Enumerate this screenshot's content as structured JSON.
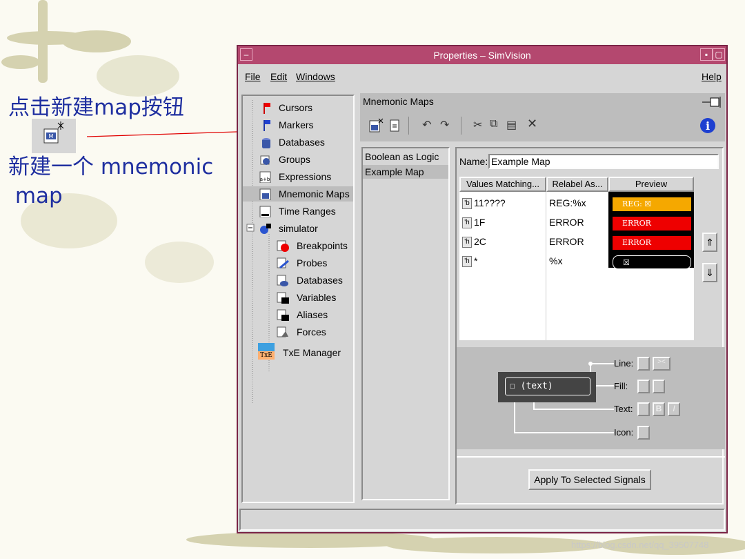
{
  "annotation": {
    "line1": "点击新建map按钮",
    "line2": "新建一个 mnemonic",
    "line3": " map"
  },
  "window": {
    "title": "Properties – SimVision",
    "menus": [
      {
        "label": "File"
      },
      {
        "label": "Edit"
      },
      {
        "label": "Windows"
      },
      {
        "label": "Help"
      }
    ]
  },
  "tree": {
    "items": [
      {
        "label": "Cursors",
        "icon": "cursor-flag-icon"
      },
      {
        "label": "Markers",
        "icon": "marker-flag-icon"
      },
      {
        "label": "Databases",
        "icon": "database-icon"
      },
      {
        "label": "Groups",
        "icon": "groups-icon"
      },
      {
        "label": "Expressions",
        "icon": "expression-icon"
      },
      {
        "label": "Mnemonic Maps",
        "icon": "mnemonic-map-icon"
      },
      {
        "label": "Time Ranges",
        "icon": "time-range-icon"
      },
      {
        "label": "simulator",
        "icon": "simulator-icon"
      },
      {
        "label": "Breakpoints",
        "icon": "breakpoint-icon"
      },
      {
        "label": "Probes",
        "icon": "probe-icon"
      },
      {
        "label": "Databases",
        "icon": "database-icon"
      },
      {
        "label": "Variables",
        "icon": "variable-icon"
      },
      {
        "label": "Aliases",
        "icon": "alias-icon"
      },
      {
        "label": "Forces",
        "icon": "force-icon"
      },
      {
        "label": "TxE Manager",
        "icon": "txe-manager-icon"
      }
    ]
  },
  "panel": {
    "title": "Mnemonic Maps",
    "maps": [
      {
        "label": "Boolean as Logic"
      },
      {
        "label": "Example Map"
      }
    ],
    "name_label": "Name:",
    "name_value": "Example Map",
    "columns": [
      "Values Matching...",
      "Relabel As...",
      "Preview"
    ],
    "rows": [
      {
        "radix": "'b",
        "value": "11????",
        "relabel": "REG:%x",
        "preview": "REG:",
        "color": "#f5a800"
      },
      {
        "radix": "'h",
        "value": "1F",
        "relabel": "ERROR",
        "preview": "ERROR",
        "color": "#ee0000"
      },
      {
        "radix": "'h",
        "value": "2C",
        "relabel": "ERROR",
        "preview": "ERROR",
        "color": "#ee0000"
      },
      {
        "radix": "'h",
        "value": "*",
        "relabel": "%x",
        "preview": "",
        "color": "#000000"
      }
    ],
    "legend": {
      "demo_text": "(text)",
      "line": "Line:",
      "fill": "Fill:",
      "text": "Text:",
      "icon": "Icon:"
    },
    "apply_label": "Apply To Selected Signals"
  },
  "watermark": "https://blog.csdn.net/qq_39507748"
}
